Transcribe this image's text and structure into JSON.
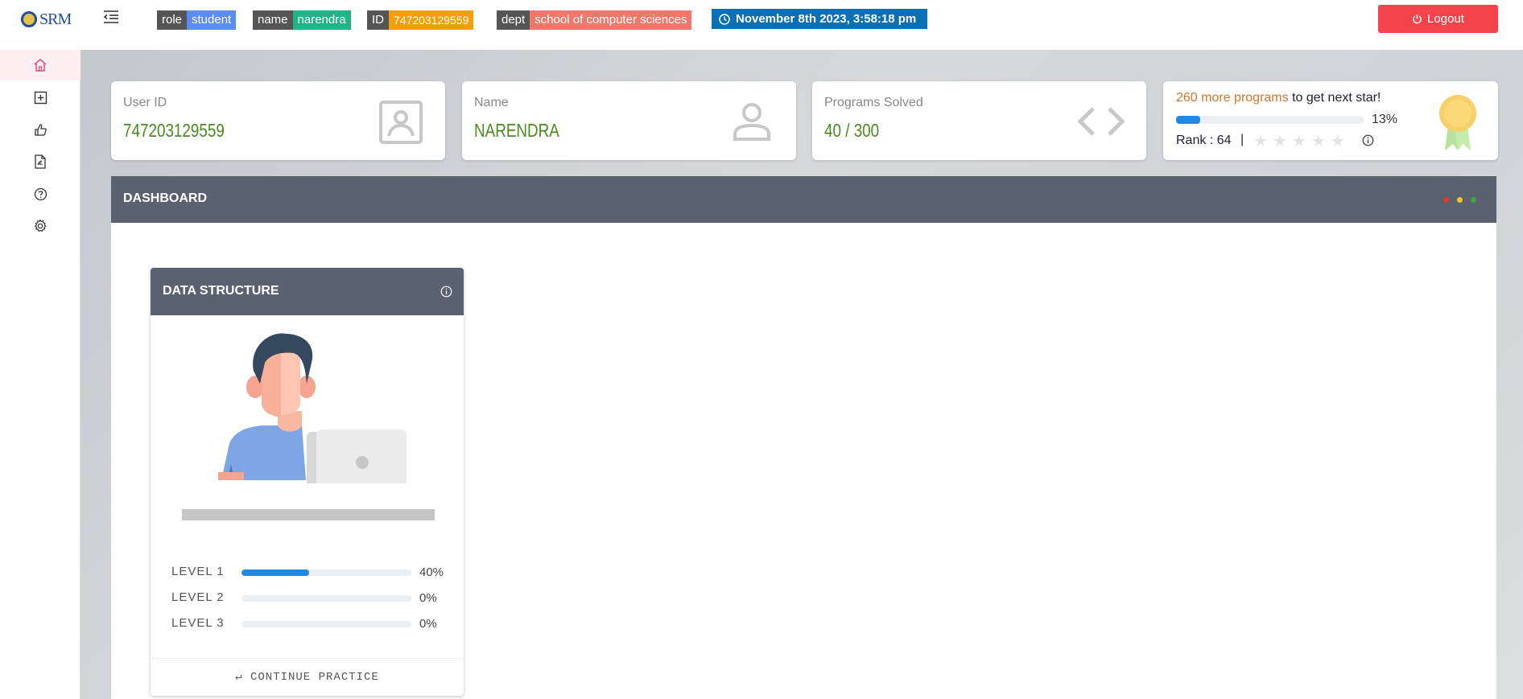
{
  "header": {
    "logo_text": "SRM",
    "badges": [
      {
        "key": "role",
        "value": "student",
        "color": "#5b8def"
      },
      {
        "key": "name",
        "value": "narendra",
        "color": "#1fb386"
      },
      {
        "key": "ID",
        "value": "747203129559",
        "color": "#f59e0b"
      },
      {
        "key": "dept",
        "value": "school of computer sciences",
        "color": "#f0786a"
      }
    ],
    "datetime": "November 8th 2023, 3:58:18 pm",
    "logout_label": "Logout"
  },
  "sidebar": {
    "items": [
      {
        "icon": "home-icon",
        "active": true
      },
      {
        "icon": "plus-square-icon",
        "active": false
      },
      {
        "icon": "thumbs-up-icon",
        "active": false
      },
      {
        "icon": "pdf-file-icon",
        "active": false
      },
      {
        "icon": "help-circle-icon",
        "active": false
      },
      {
        "icon": "gear-icon",
        "active": false
      }
    ]
  },
  "cards": {
    "user_id": {
      "label": "User ID",
      "value": "747203129559"
    },
    "name": {
      "label": "Name",
      "value": "NARENDRA"
    },
    "programs": {
      "label": "Programs Solved",
      "value": "40 / 300"
    },
    "star": {
      "count_text": "260 more programs",
      "rest_text": "to get next star!",
      "progress_pct": 13,
      "progress_label": "13%",
      "rank_label": "Rank : 64",
      "separator": "|",
      "stars_filled": 0,
      "stars_total": 5
    }
  },
  "dashboard": {
    "title": "DASHBOARD",
    "window_dots": [
      "#e53935",
      "#fbc02d",
      "#43a047"
    ],
    "course": {
      "title": "DATA STRUCTURE",
      "levels": [
        {
          "label": "LEVEL 1",
          "pct": 40,
          "pct_label": "40%"
        },
        {
          "label": "LEVEL 2",
          "pct": 0,
          "pct_label": "0%"
        },
        {
          "label": "LEVEL 3",
          "pct": 0,
          "pct_label": "0%"
        }
      ],
      "continue_label": "CONTINUE PRACTICE"
    }
  }
}
